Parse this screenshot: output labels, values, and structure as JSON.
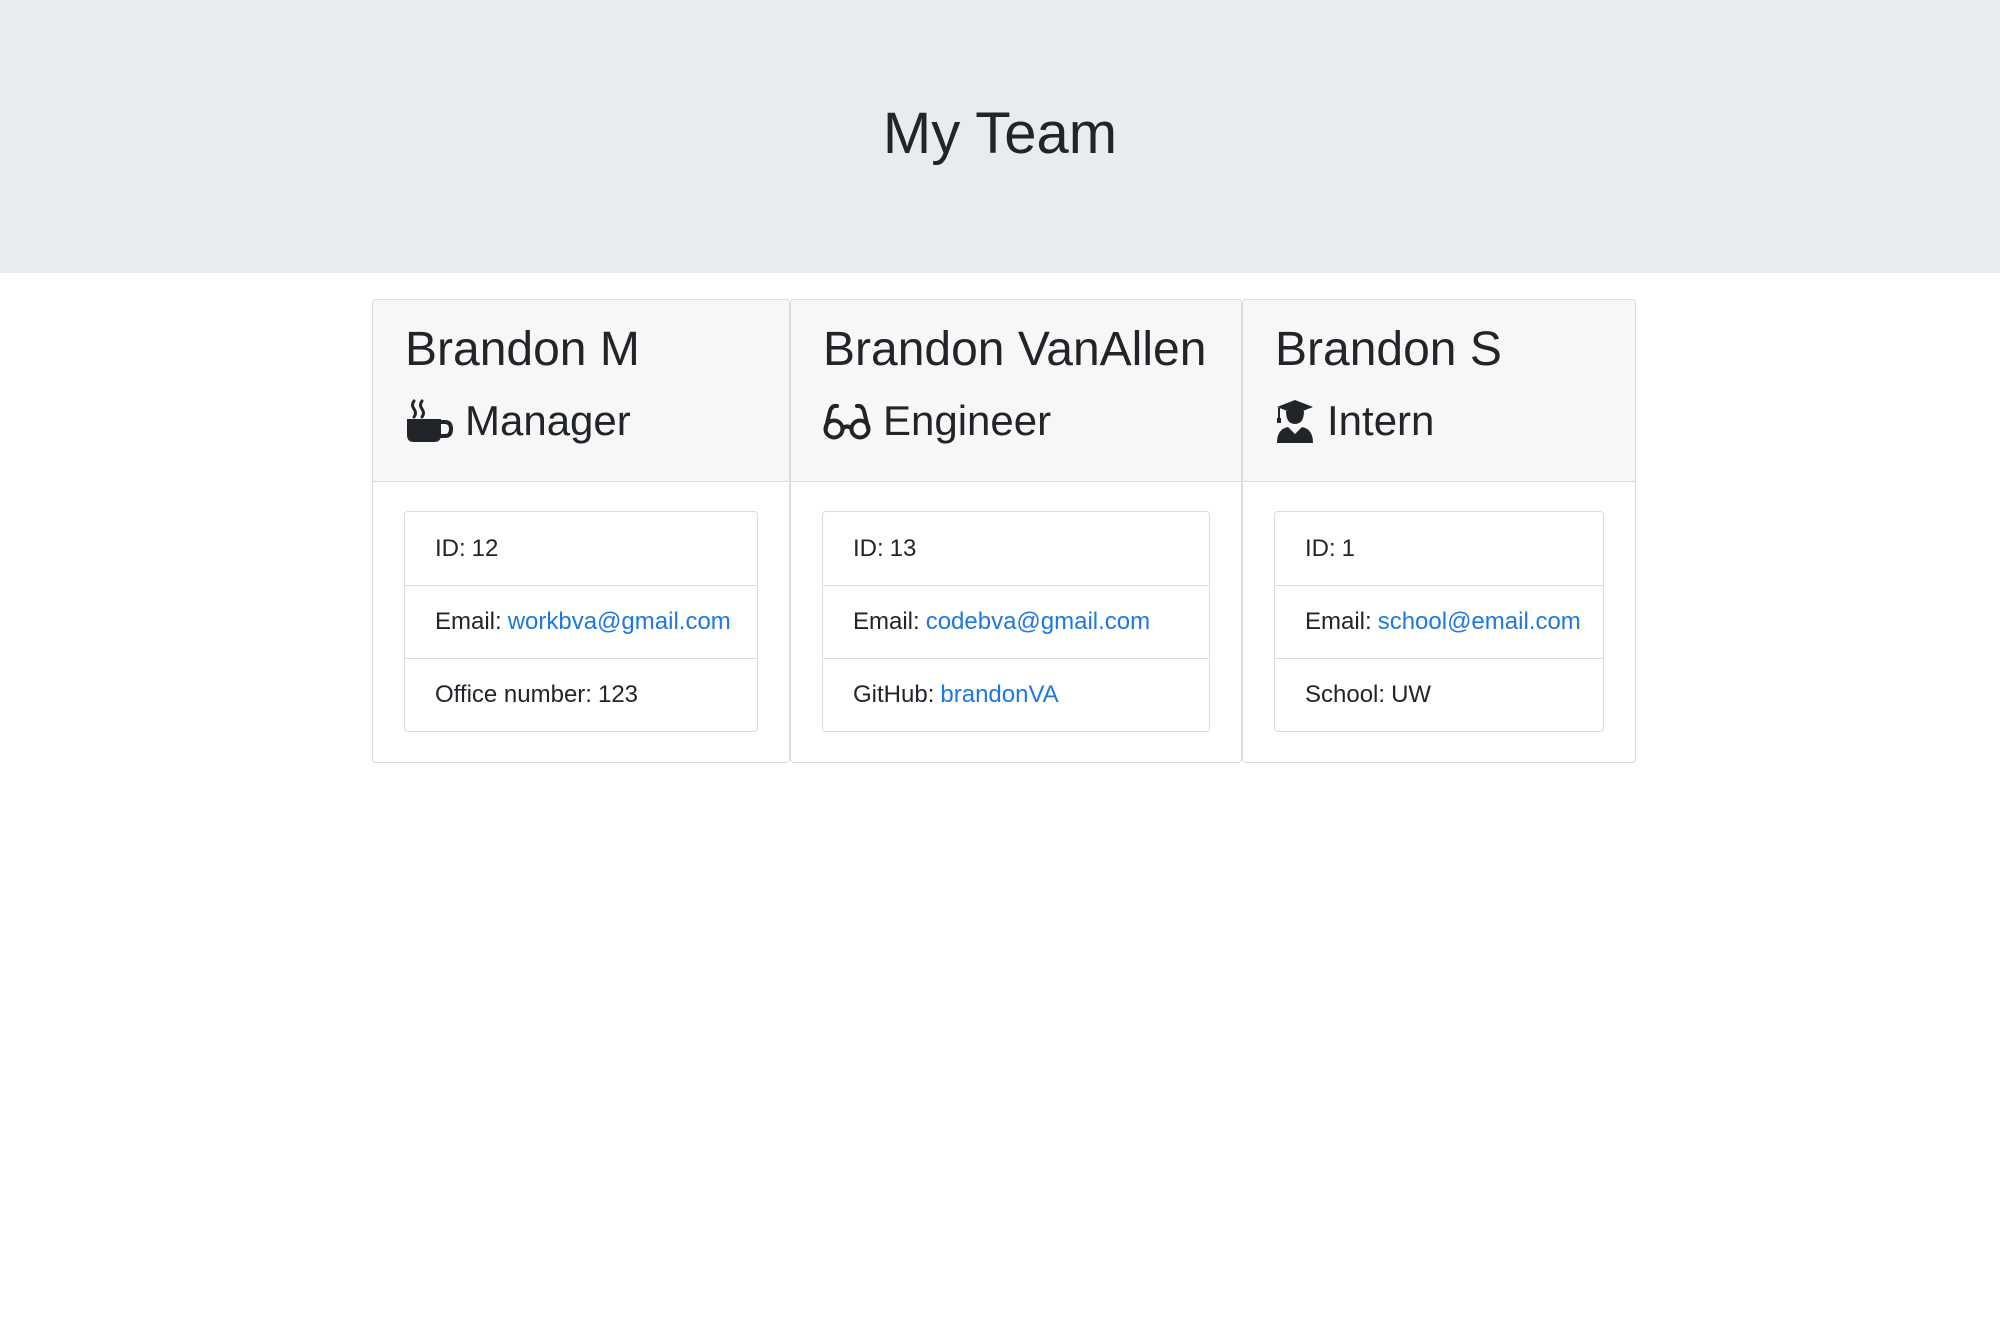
{
  "header": {
    "title": "My Team"
  },
  "team": [
    {
      "name": "Brandon M",
      "role": "Manager",
      "role_icon": "coffee-mug-icon",
      "id_label": "ID:",
      "id": "12",
      "email_label": "Email:",
      "email": "workbva@gmail.com",
      "extra_label": "Office number:",
      "extra": "123"
    },
    {
      "name": "Brandon VanAllen",
      "role": "Engineer",
      "role_icon": "glasses-icon",
      "id_label": "ID:",
      "id": "13",
      "email_label": "Email:",
      "email": "codebva@gmail.com",
      "extra_label": "GitHub:",
      "extra": "brandonVA"
    },
    {
      "name": "Brandon S",
      "role": "Intern",
      "role_icon": "graduate-icon",
      "id_label": "ID:",
      "id": "1",
      "email_label": "Email:",
      "email": "school@email.com",
      "extra_label": "School:",
      "extra": "UW"
    }
  ],
  "colors": {
    "jumbotron_bg": "#e9ecef",
    "link": "#1e78e3",
    "card_header_bg": "#f7f7f7",
    "text": "#212529"
  }
}
